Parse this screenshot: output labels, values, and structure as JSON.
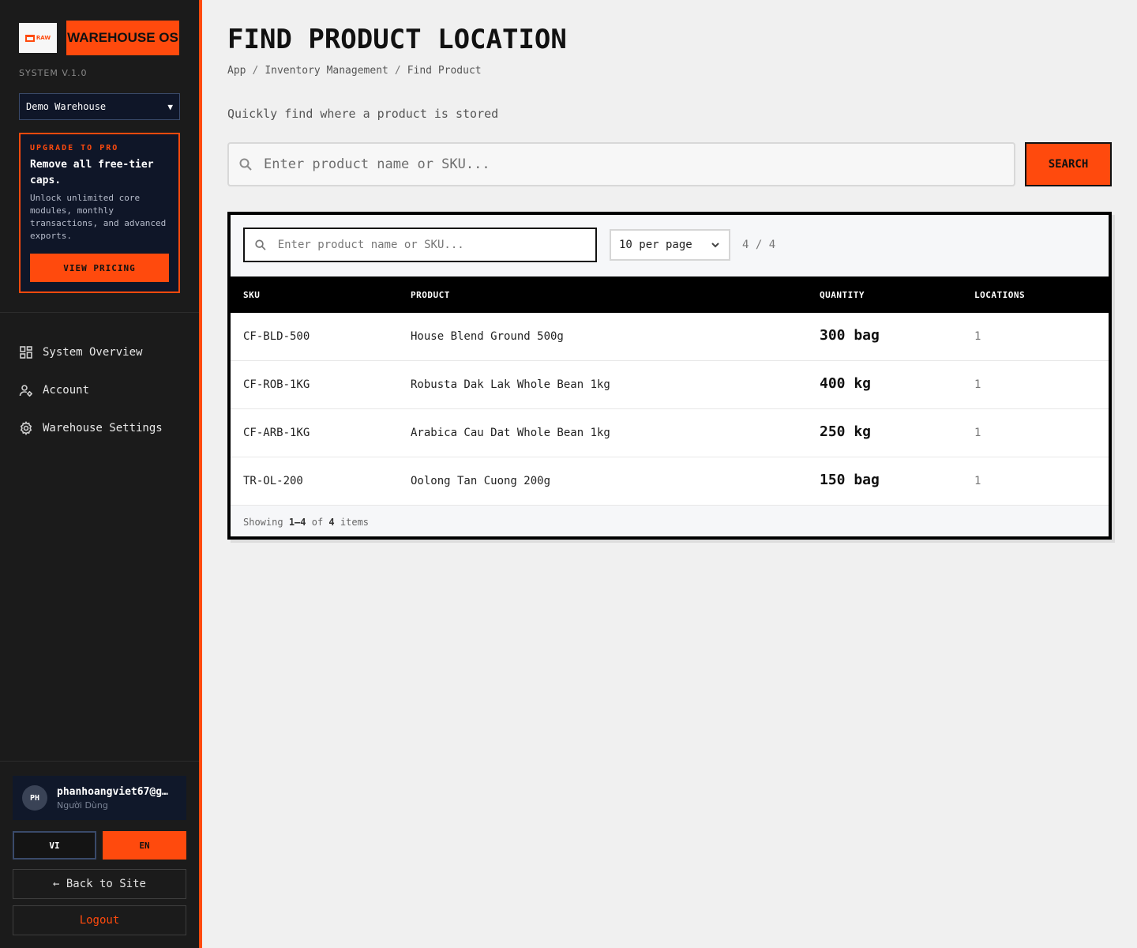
{
  "sidebar": {
    "brand": {
      "logo_text": "RAW",
      "name": "WAREHOUSE OS"
    },
    "version": "SYSTEM V.1.0",
    "warehouse_select": {
      "value": "Demo Warehouse"
    },
    "upgrade": {
      "tag": "UPGRADE TO PRO",
      "headline": "Remove all free-tier caps.",
      "description": "Unlock unlimited core modules, monthly transactions, and advanced exports.",
      "button": "VIEW PRICING"
    },
    "nav": [
      {
        "label": "System Overview",
        "icon": "dashboard-icon"
      },
      {
        "label": "Account",
        "icon": "user-settings-icon"
      },
      {
        "label": "Warehouse Settings",
        "icon": "gear-icon"
      }
    ],
    "user": {
      "initials": "PH",
      "email": "phanhoangviet67@g…",
      "role": "Người Dùng"
    },
    "lang": {
      "vi": "VI",
      "en": "EN",
      "active": "EN"
    },
    "back_label": "← Back to Site",
    "logout_label": "Logout"
  },
  "main": {
    "title": "FIND PRODUCT LOCATION",
    "breadcrumb": [
      "App",
      "Inventory Management",
      "Find Product"
    ],
    "subtitle": "Quickly find where a product is stored",
    "search": {
      "placeholder": "Enter product name or SKU...",
      "button": "SEARCH"
    },
    "table": {
      "filter_placeholder": "Enter product name or SKU...",
      "per_page": "10 per page",
      "counter": "4 / 4",
      "columns": [
        "SKU",
        "PRODUCT",
        "QUANTITY",
        "LOCATIONS"
      ],
      "rows": [
        {
          "sku": "CF-BLD-500",
          "product": "House Blend Ground 500g",
          "quantity": "300 bag",
          "locations": "1"
        },
        {
          "sku": "CF-ROB-1KG",
          "product": "Robusta Dak Lak Whole Bean 1kg",
          "quantity": "400 kg",
          "locations": "1"
        },
        {
          "sku": "CF-ARB-1KG",
          "product": "Arabica Cau Dat Whole Bean 1kg",
          "quantity": "250 kg",
          "locations": "1"
        },
        {
          "sku": "TR-OL-200",
          "product": "Oolong Tan Cuong 200g",
          "quantity": "150 bag",
          "locations": "1"
        }
      ],
      "footer": {
        "prefix": "Showing",
        "range": "1–4",
        "of": "of",
        "total": "4",
        "suffix": "items"
      }
    }
  },
  "colors": {
    "accent": "#ff4a0d",
    "sidebar_bg": "#1b1b1b",
    "page_bg": "#f0f0f0",
    "panel_navy": "#0f1628"
  }
}
